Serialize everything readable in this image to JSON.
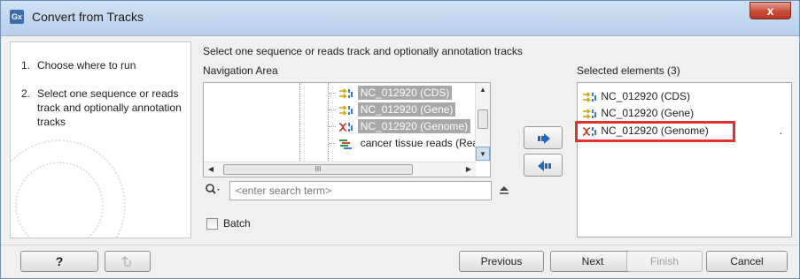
{
  "window": {
    "title": "Convert from Tracks",
    "app_icon_text": "Gx",
    "close_glyph": "x"
  },
  "steps": [
    {
      "number": "1.",
      "label": "Choose where to run"
    },
    {
      "number": "2.",
      "label": "Select one sequence or reads track and optionally annotation tracks"
    }
  ],
  "instruction": "Select one sequence or reads track and optionally annotation tracks",
  "navigation": {
    "label": "Navigation Area",
    "items": [
      {
        "label": "NC_012920 (CDS)",
        "icon": "annotation-track-icon",
        "selected": true
      },
      {
        "label": "NC_012920 (Gene)",
        "icon": "annotation-track-icon",
        "selected": true
      },
      {
        "label": "NC_012920 (Genome)",
        "icon": "sequence-track-icon",
        "selected": true
      },
      {
        "label": "cancer tissue reads (Reads",
        "icon": "reads-track-icon",
        "selected": false
      }
    ],
    "hscroll_thumb_glyph": "III"
  },
  "search": {
    "placeholder": "<enter search term>",
    "value": ""
  },
  "batch_label": "Batch",
  "selected": {
    "label": "Selected elements (3)",
    "items": [
      {
        "label": "NC_012920 (CDS)",
        "icon": "annotation-track-icon"
      },
      {
        "label": "NC_012920 (Gene)",
        "icon": "annotation-track-icon"
      },
      {
        "label": "NC_012920 (Genome)",
        "icon": "sequence-track-icon",
        "trailing": "."
      }
    ]
  },
  "footer": {
    "help": "?",
    "previous": "Previous",
    "next": "Next",
    "finish": "Finish",
    "cancel": "Cancel"
  },
  "colors": {
    "selection_gray": "#a8a8a8",
    "highlight_red": "#e0332f",
    "arrow_blue": "#1f67c2"
  }
}
